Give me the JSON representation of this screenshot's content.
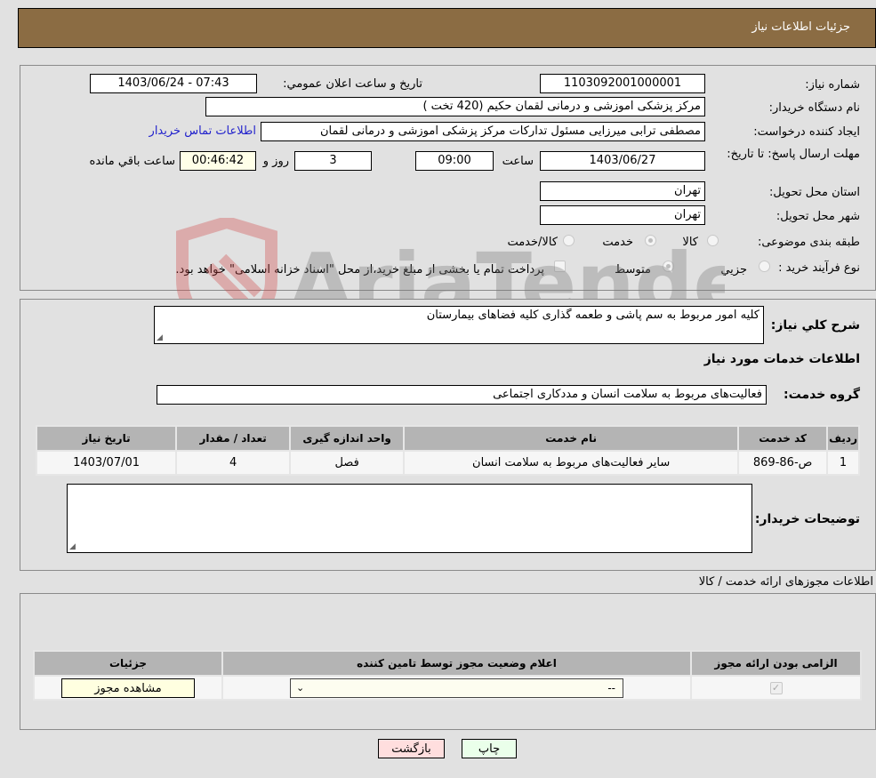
{
  "header": {
    "title": "جزئیات اطلاعات نیاز"
  },
  "form": {
    "need_number_label": "شماره نیاز:",
    "need_number": "1103092001000001",
    "announce_label": "تاریخ و ساعت اعلان عمومي:",
    "announce_value": "1403/06/24 - 07:43",
    "buyer_org_label": "نام دستگاه خریدار:",
    "buyer_org": "مرکز پزشکی   اموزشی و درمانی لقمان حکیم (420 تخت )",
    "creator_label": "ایجاد کننده درخواست:",
    "creator": "مصطفی ترابی میرزایی مسئول تداركات مرکز پزشکی   اموزشی و درمانی لقمان",
    "contact_link": "اطلاعات تماس خریدار",
    "deadline_label": "مهلت ارسال پاسخ: تا تاریخ:",
    "deadline_date": "1403/06/27",
    "time_label": "ساعت",
    "deadline_time": "09:00",
    "days_value": "3",
    "days_label": "روز و",
    "remaining_time": "00:46:42",
    "remaining_label": "ساعت باقي مانده",
    "province_label": "استان محل تحویل:",
    "province": "تهران",
    "city_label": "شهر محل تحویل:",
    "city": "تهران",
    "category_label": "طبقه بندی موضوعی:",
    "category_options": [
      {
        "label": "کالا",
        "selected": false
      },
      {
        "label": "خدمت",
        "selected": true
      },
      {
        "label": "کالا/خدمت",
        "selected": false
      }
    ],
    "process_label": "نوع فرآیند خرید :",
    "process_options": [
      {
        "label": "جزیي",
        "selected": false
      },
      {
        "label": "متوسط",
        "selected": true
      }
    ],
    "treasury_note": "پرداخت تمام یا بخشی از مبلغ خرید،از محل \"اسناد خزانه اسلامی\" خواهد بود."
  },
  "description": {
    "label": "شرح کلي نیاز:",
    "value": "کلیه امور مربوط به سم پاشی و طعمه گذاری کلیه فضاهای بیمارستان"
  },
  "services": {
    "section_title": "اطلاعات خدمات مورد نیاز",
    "group_label": "گروه خدمت:",
    "group_value": "فعالیت‌های مربوط به سلامت انسان و مددکاری اجتماعی",
    "columns": [
      "ردیف",
      "کد خدمت",
      "نام خدمت",
      "واحد اندازه گیری",
      "تعداد / مقدار",
      "تاریخ نیاز"
    ],
    "rows": [
      [
        "1",
        "ص-86-869",
        "سایر فعالیت‌های مربوط به سلامت انسان",
        "فصل",
        "4",
        "1403/07/01"
      ]
    ]
  },
  "buyer_notes": {
    "label": "توضیحات خریدار:",
    "value": ""
  },
  "permits": {
    "section_title": "اطلاعات مجوزهای ارائه خدمت / کالا",
    "columns": [
      "الزامی بودن ارائه مجوز",
      "اعلام وضعیت مجوز توسط تامین کننده",
      "جزئیات"
    ],
    "row": {
      "required": true,
      "status_selected": "--",
      "details_button": "مشاهده مجوز"
    }
  },
  "buttons": {
    "print": "چاپ",
    "back": "بازگشت"
  },
  "watermark": "AriaTender.neT"
}
